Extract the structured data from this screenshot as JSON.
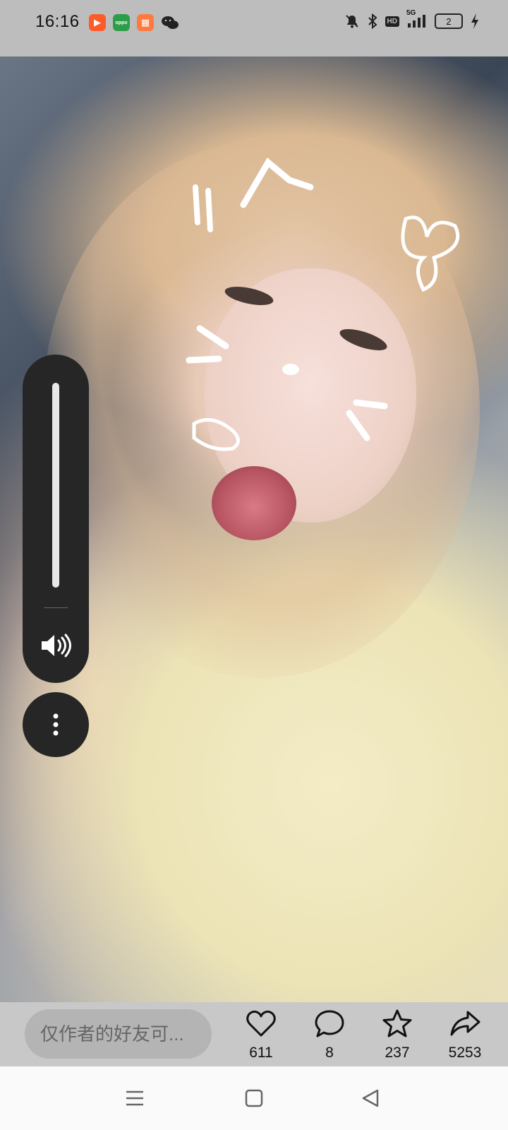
{
  "status_bar": {
    "time": "16:16",
    "app_icons": [
      "video-app-icon",
      "oppo-store-icon",
      "reader-app-icon",
      "wechat-icon"
    ],
    "hd_label": "HD",
    "network_label": "5G",
    "battery_label": "2"
  },
  "video": {
    "description_icon": "video-frame"
  },
  "volume_panel": {
    "level_percent": 100,
    "icon": "speaker-icon"
  },
  "more_button": {
    "icon": "vertical-ellipsis-icon"
  },
  "action_bar": {
    "comment_placeholder": "仅作者的好友可...",
    "like_count": "611",
    "comment_count": "8",
    "favorite_count": "237",
    "share_count": "5253"
  },
  "nav_bar": {
    "menu_icon": "menu-icon",
    "home_icon": "square-home-icon",
    "back_icon": "triangle-back-icon"
  },
  "colors": {
    "status_bg": "#bdbdbd",
    "action_bar_bg": "#c8c8c8",
    "panel_bg": "#262626"
  }
}
